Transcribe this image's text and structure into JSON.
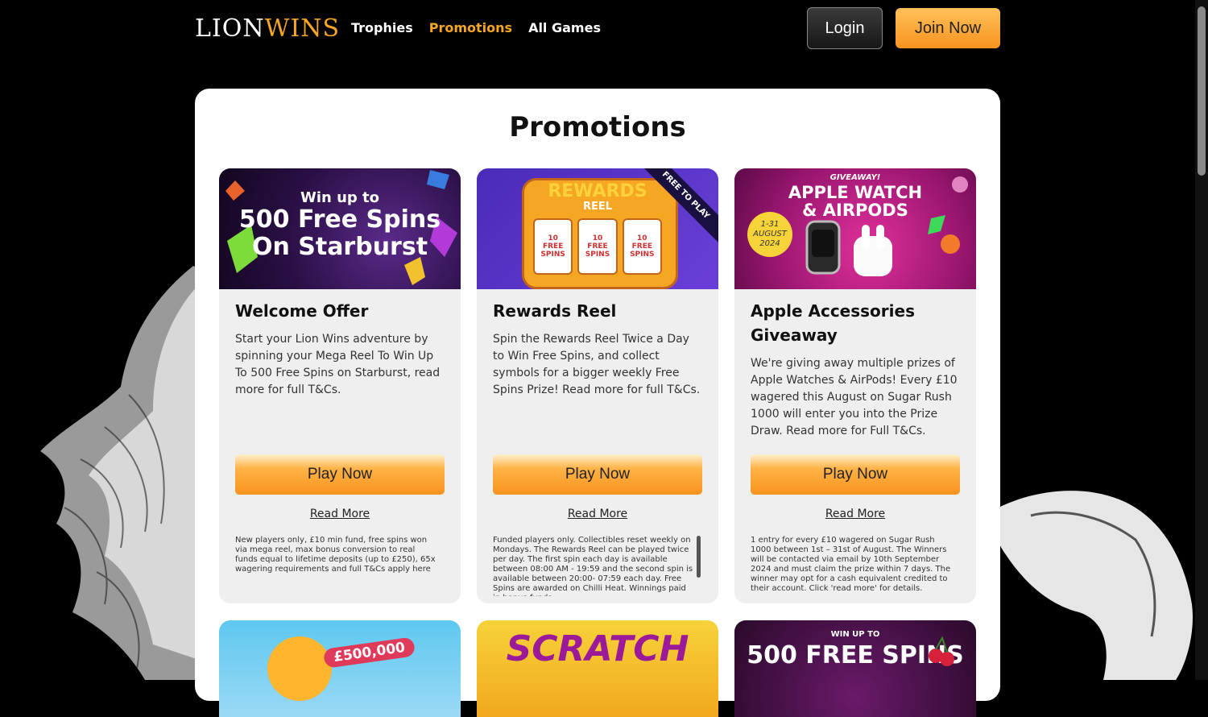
{
  "header": {
    "logo_lion": "LION",
    "logo_wins": "WINS",
    "nav": [
      {
        "label": "Trophies"
      },
      {
        "label": "Promotions"
      },
      {
        "label": "All Games"
      }
    ],
    "login_label": "Login",
    "join_label": "Join Now"
  },
  "page": {
    "title": "Promotions"
  },
  "colors": {
    "accent": "#f5a623",
    "background": "#000000",
    "panel": "#ffffff",
    "card": "#efefef"
  },
  "promotions": [
    {
      "banner": {
        "line1": "Win up to",
        "line2": "500 Free Spins",
        "line3": "On Starburst"
      },
      "title": "Welcome Offer",
      "description": "Start your Lion Wins adventure by spinning your Mega Reel To Win Up To 500 Free Spins on Starburst, read more for full T&Cs.",
      "play_label": "Play Now",
      "read_more_label": "Read More",
      "terms": "New players only, £10 min fund, free spins won via mega reel, max bonus conversion to real funds equal to lifetime deposits (up to £250), 65x wagering requirements and full T&Cs apply here"
    },
    {
      "banner": {
        "line1": "REWARDS",
        "line2": "REEL",
        "reel_label": "10 FREE SPINS",
        "ribbon": "FREE TO PLAY"
      },
      "title": "Rewards Reel",
      "description": "Spin the Rewards Reel Twice a Day to Win Free Spins, and collect symbols for a bigger weekly Free Spins Prize! Read more for full T&Cs.",
      "play_label": "Play Now",
      "read_more_label": "Read More",
      "terms": "Funded players only. Collectibles reset weekly on Mondays. The Rewards Reel can be played twice per day. The first spin each day is available between 08:00 AM - 19:59 and the second spin is available between 20:00- 07:59 each day. Free Spins are awarded on Chilli Heat. Winnings paid in bonus funds."
    },
    {
      "banner": {
        "line0": "GIVEAWAY!",
        "line1": "APPLE WATCH",
        "line2": "& AIRPODS",
        "date1": "1-31",
        "date2": "AUGUST",
        "date3": "2024"
      },
      "title": "Apple Accessories Giveaway",
      "description": "We're giving away multiple prizes of Apple Watches & AirPods! Every £10 wagered this August on Sugar Rush 1000 will enter you into the Prize Draw. Read more for Full T&Cs.",
      "play_label": "Play Now",
      "read_more_label": "Read More",
      "terms": "1 entry for every £10 wagered on Sugar Rush 1000 between 1st – 31st of August. The Winners will be contacted via email by 10th September 2024 and must claim the prize within 7 days. The winner may opt for a cash equivalent credited to their account. Click 'read more' for details."
    }
  ],
  "second_row": [
    {
      "banner_text": "£500,000"
    },
    {
      "banner_text": "SCRATCH"
    },
    {
      "banner_small": "WIN UP TO",
      "banner_text": "500 FREE SPINS"
    }
  ]
}
